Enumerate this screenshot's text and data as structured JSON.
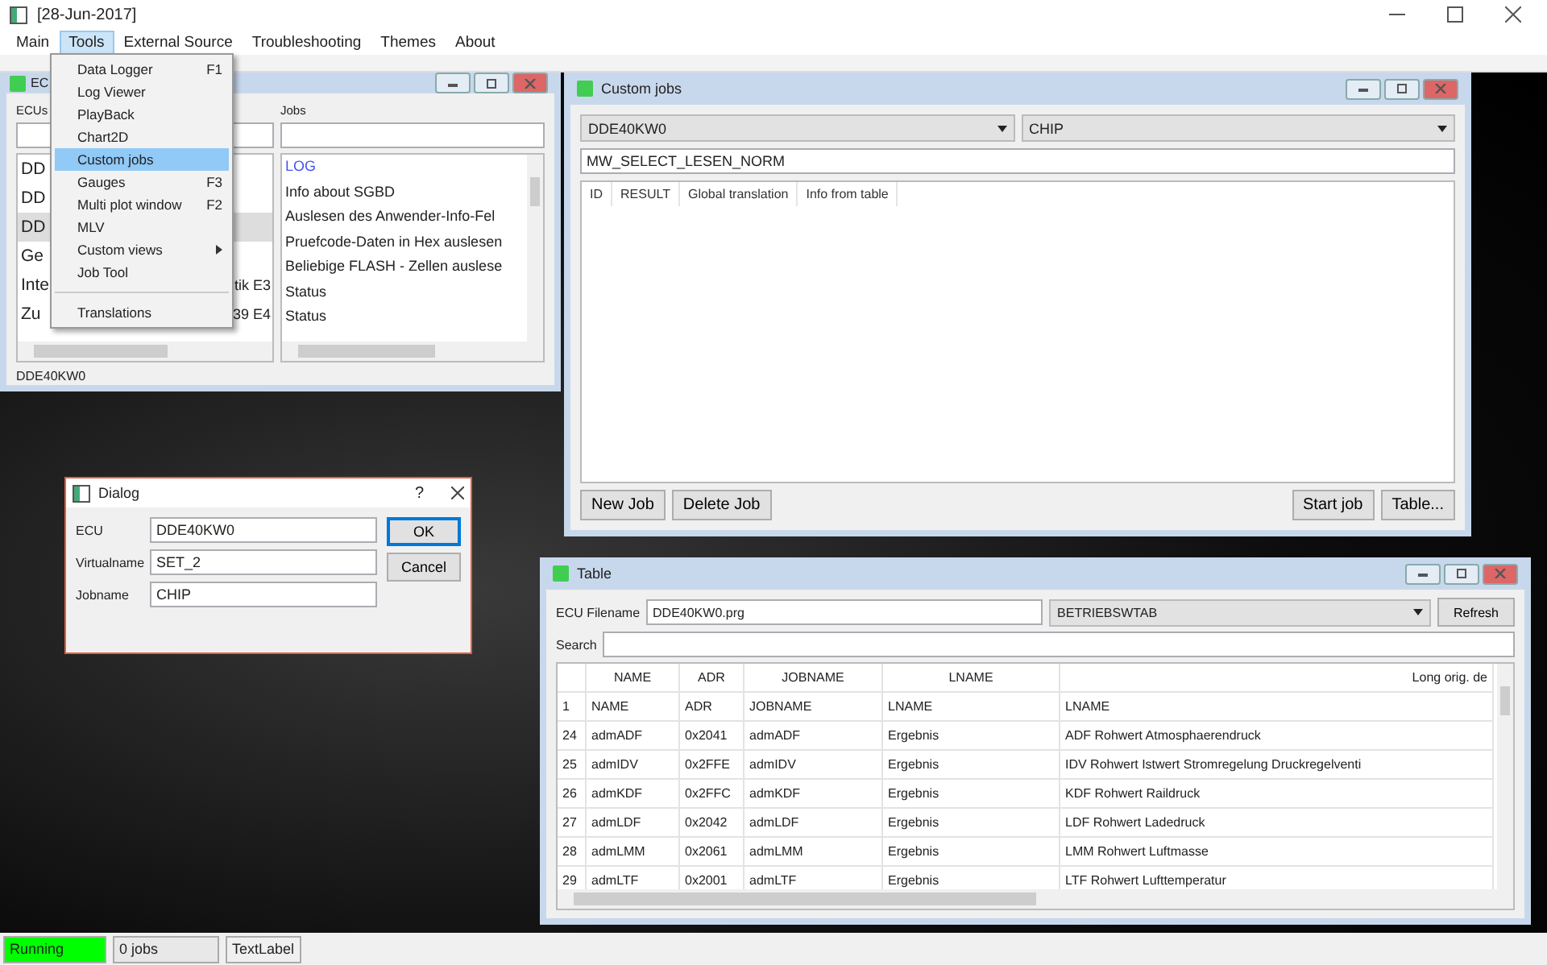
{
  "window": {
    "title": "[28-Jun-2017]"
  },
  "menu_bar": [
    {
      "label": "Main",
      "selected": false
    },
    {
      "label": "Tools",
      "selected": true
    },
    {
      "label": "External Source",
      "selected": false
    },
    {
      "label": "Troubleshooting",
      "selected": false
    },
    {
      "label": "Themes",
      "selected": false
    },
    {
      "label": "About",
      "selected": false
    }
  ],
  "tools_menu": [
    {
      "kind": "item",
      "label": "Data Logger",
      "shortcut": "F1",
      "selected": false
    },
    {
      "kind": "item",
      "label": "Log Viewer",
      "selected": false
    },
    {
      "kind": "item",
      "label": "PlayBack",
      "selected": false
    },
    {
      "kind": "item",
      "label": "Chart2D",
      "selected": false
    },
    {
      "kind": "item",
      "label": "Custom jobs",
      "selected": true
    },
    {
      "kind": "item",
      "label": "Gauges",
      "shortcut": "F3",
      "selected": false
    },
    {
      "kind": "item",
      "label": "Multi plot window",
      "shortcut": "F2",
      "selected": false
    },
    {
      "kind": "item",
      "label": "MLV",
      "selected": false
    },
    {
      "kind": "submenu",
      "label": "Custom views",
      "selected": false
    },
    {
      "kind": "item",
      "label": "Job Tool",
      "selected": false
    },
    {
      "kind": "separator"
    },
    {
      "kind": "item",
      "label": "Translations",
      "selected": false
    }
  ],
  "ecu_window": {
    "title": "EC",
    "ecus_label": "ECUs",
    "jobs_label": "Jobs",
    "ecus": [
      {
        "text": "DD",
        "selected": false
      },
      {
        "text": "DD",
        "selected": false
      },
      {
        "text": "DD",
        "selected": true
      },
      {
        "text": "Ge",
        "selected": false
      },
      {
        "text": "Inte",
        "tail": "tik E3",
        "selected": false
      },
      {
        "text": "Zu",
        "tail": "39 E4",
        "selected": false
      }
    ],
    "jobs": [
      {
        "kind": "log",
        "text": "LOG"
      },
      {
        "kind": "job",
        "text": "Info about SGBD"
      },
      {
        "kind": "job",
        "text": "Auslesen des Anwender-Info-Fel"
      },
      {
        "kind": "job",
        "text": "Pruefcode-Daten in Hex auslesen"
      },
      {
        "kind": "job",
        "text": "Beliebige FLASH - Zellen auslese"
      },
      {
        "kind": "job",
        "text": "Status"
      },
      {
        "kind": "job",
        "text": "Status"
      }
    ],
    "status": "DDE40KW0"
  },
  "custom_jobs": {
    "title": "Custom jobs",
    "ecu_combo": "DDE40KW0",
    "job_combo": "CHIP",
    "result_field": "MW_SELECT_LESEN_NORM",
    "columns": [
      "ID",
      "RESULT",
      "Global translation",
      "Info from table"
    ],
    "buttons_left": [
      "New Job",
      "Delete Job"
    ],
    "buttons_right": [
      "Start job",
      "Table..."
    ]
  },
  "dialog": {
    "title": "Dialog",
    "help": "?",
    "fields": [
      {
        "label": "ECU",
        "value": "DDE40KW0"
      },
      {
        "label": "Virtualname",
        "value": "SET_2"
      },
      {
        "label": "Jobname",
        "value": "CHIP"
      }
    ],
    "buttons": [
      {
        "label": "OK",
        "focused": true
      },
      {
        "label": "Cancel",
        "focused": false
      }
    ]
  },
  "table_window": {
    "title": "Table",
    "filename_label": "ECU Filename",
    "filename": "DDE40KW0.prg",
    "table_combo": "BETRIEBSWTAB",
    "refresh": "Refresh",
    "search_label": "Search",
    "columns": [
      "NAME",
      "ADR",
      "JOBNAME",
      "LNAME",
      "Long orig. de"
    ],
    "rows": [
      {
        "index": "1",
        "cells": [
          "NAME",
          "ADR",
          "JOBNAME",
          "LNAME",
          "LNAME"
        ]
      },
      {
        "index": "24",
        "cells": [
          "admADF",
          "0x2041",
          "admADF",
          "Ergebnis",
          "ADF Rohwert Atmosphaerendruck"
        ]
      },
      {
        "index": "25",
        "cells": [
          "admIDV",
          "0x2FFE",
          "admIDV",
          "Ergebnis",
          "IDV Rohwert Istwert Stromregelung Druckregelventi"
        ]
      },
      {
        "index": "26",
        "cells": [
          "admKDF",
          "0x2FFC",
          "admKDF",
          "Ergebnis",
          "KDF Rohwert Raildruck"
        ]
      },
      {
        "index": "27",
        "cells": [
          "admLDF",
          "0x2042",
          "admLDF",
          "Ergebnis",
          "LDF Rohwert Ladedruck"
        ]
      },
      {
        "index": "28",
        "cells": [
          "admLMM",
          "0x2061",
          "admLMM",
          "Ergebnis",
          "LMM Rohwert Luftmasse"
        ]
      },
      {
        "index": "29",
        "cells": [
          "admLTF",
          "0x2001",
          "admLTF",
          "Ergebnis",
          "LTF Rohwert Lufttemperatur"
        ]
      }
    ]
  },
  "status_bar": [
    {
      "kind": "state",
      "text": "Running"
    },
    {
      "kind": "count",
      "text": "0 jobs"
    },
    {
      "kind": "label",
      "text": "TextLabel"
    }
  ]
}
